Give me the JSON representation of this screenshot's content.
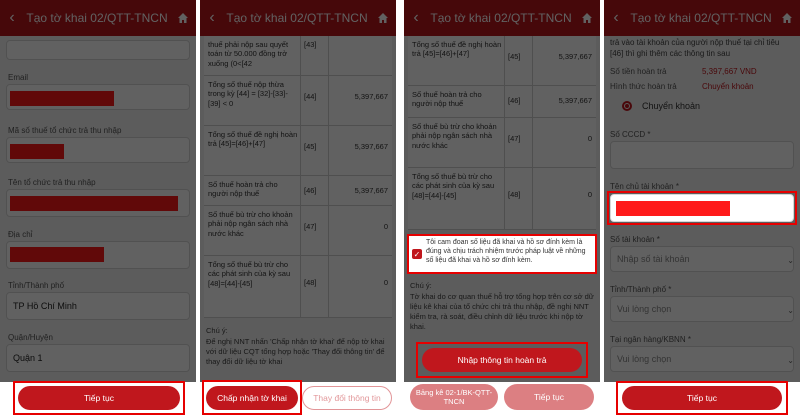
{
  "header_title": "Tạo tờ khai 02/QTT-TNCN",
  "panel1": {
    "email_label": "Email",
    "org_tax_label": "Mã số thuế tổ chức trả thu nhập",
    "org_name_label": "Tên tổ chức trả thu nhập",
    "address_label": "Địa chỉ",
    "province_label": "Tỉnh/Thành phố",
    "province_value": "TP Hồ Chí Minh",
    "district_label": "Quận/Huyện",
    "district_value": "Quận 1",
    "continue_label": "Tiếp tục"
  },
  "panel2": {
    "rows": [
      {
        "label": "thuế phải nộp sau quyết toán từ 50.000 đồng trở xuống (0<[42",
        "code": "[43]",
        "value": ""
      },
      {
        "label": "Tổng số thuế nộp thừa trong kỳ [44] = [32]-[33]-[39] < 0",
        "code": "[44]",
        "value": "5,397,667"
      },
      {
        "label": "Tổng số thuế đề nghị hoàn trả [45]=[46]+[47]",
        "code": "[45]",
        "value": "5,397,667"
      },
      {
        "label": "Số thuế hoàn trả cho người nộp thuế",
        "code": "[46]",
        "value": "5,397,667"
      },
      {
        "label": "Số thuế bù trừ cho khoản phải nộp ngân sách nhà nước khác",
        "code": "[47]",
        "value": "0"
      },
      {
        "label": "Tổng số thuế bù trừ cho các phát sinh của kỳ sau [48]=[44]-[45]",
        "code": "[48]",
        "value": "0"
      }
    ],
    "note_title": "Chú ý:",
    "note_text": "Để nghị NNT nhấn 'Chấp nhận tờ khai' để nộp tờ khai với dữ liệu CQT tổng hợp hoặc 'Thay đổi thông tin' để thay đổi dữ liệu tờ khai",
    "accept_label": "Chấp nhận tờ khai",
    "change_label": "Thay đổi thông tin"
  },
  "panel3": {
    "rows": [
      {
        "label": "Tổng số thuế đề nghị hoàn trả [45]=[46]+[47]",
        "code": "[45]",
        "value": "5,397,667"
      },
      {
        "label": "Số thuế hoàn trả cho người nộp thuế",
        "code": "[46]",
        "value": "5,397,667"
      },
      {
        "label": "Số thuế bù trừ cho khoản phải nộp ngân sách nhà nước khác",
        "code": "[47]",
        "value": "0"
      },
      {
        "label": "Tổng số thuế bù trừ cho các phát sinh của kỳ sau [48]=[44]-[45]",
        "code": "[48]",
        "value": "0"
      }
    ],
    "commit_text": "Tôi cam đoan số liệu đã khai và hồ sơ đính kèm là đúng và chịu trách nhiệm trước pháp luật về những số liệu đã khai và hồ sơ đính kèm.",
    "note_title": "Chú ý:",
    "note_text": "Tờ khai do cơ quan thuế hỗ trợ tổng hợp trên cơ sở dữ liệu kê khai của tổ chức chi trả thu nhập, đề nghị NNT kiểm tra, rà soát, điều chỉnh dữ liệu trước khi nộp tờ khai.",
    "refund_btn": "Nhập thông tin hoàn trả",
    "attach_btn": "Bảng kê 02-1/BK-QTT-TNCN",
    "continue_label": "Tiếp tục"
  },
  "panel4": {
    "intro_text": "trả vào tài khoản của người nộp thuế tại chỉ tiêu [46] thì ghi thêm các thông tin sau",
    "amount_label": "Số tiền hoàn trả",
    "amount_value": "5,397,667 VND",
    "method_label": "Hình thức hoàn trả",
    "method_value": "Chuyển khoản",
    "radio_label": "Chuyển khoản",
    "cccd_label": "Số CCCD *",
    "owner_label": "Tên chủ tài khoản *",
    "account_label": "Số tài khoản *",
    "account_placeholder": "Nhập số tài khoản",
    "province_label": "Tỉnh/Thành phố *",
    "province_placeholder": "Vui lòng chọn",
    "bank_label": "Tại ngân hàng/KBNN *",
    "bank_placeholder": "Vui lòng chọn",
    "continue_label": "Tiếp tục"
  },
  "colors": {
    "brand": "#b8161c",
    "highlight": "#e60000"
  }
}
